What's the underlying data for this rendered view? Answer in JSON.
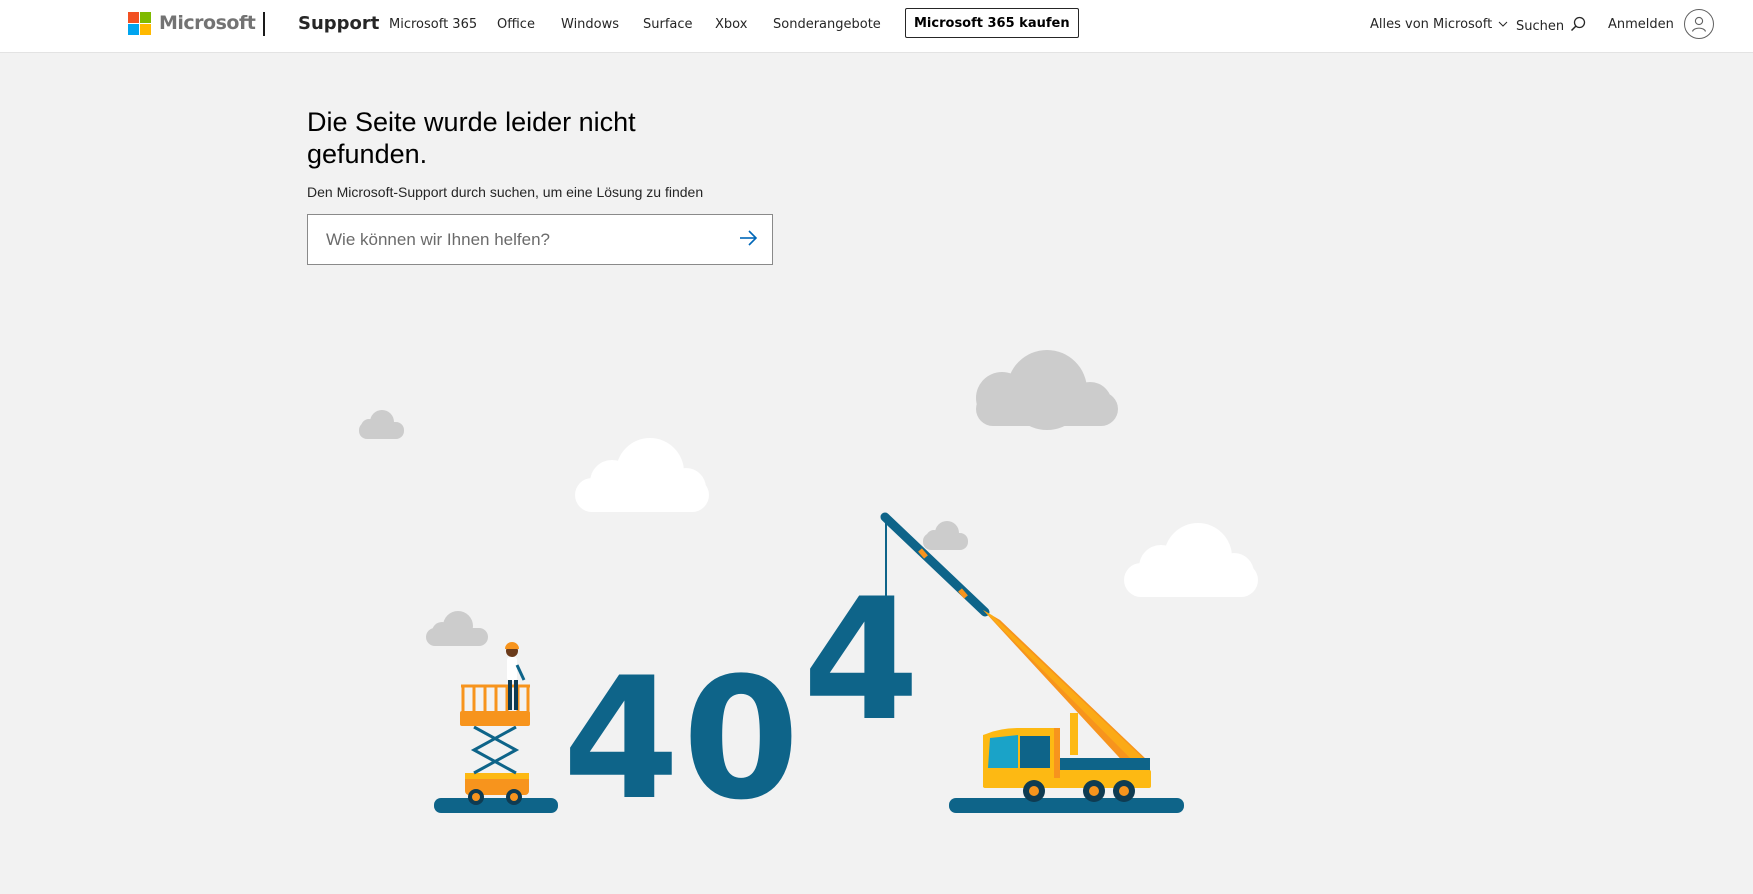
{
  "header": {
    "logo_text": "Microsoft",
    "logo_colors": [
      "#f25022",
      "#7fba00",
      "#00a4ef",
      "#ffb900"
    ],
    "support_label": "Support",
    "nav_items": [
      "Microsoft 365",
      "Office",
      "Windows",
      "Surface",
      "Xbox",
      "Sonderangebote"
    ],
    "buy_button_label": "Microsoft 365 kaufen",
    "all_microsoft_label": "Alles von Microsoft",
    "search_label": "Suchen",
    "signin_label": "Anmelden"
  },
  "main": {
    "title": "Die Seite wurde leider nicht gefunden.",
    "subtitle": "Den Microsoft-Support durch suchen, um eine Lösung zu finden",
    "search": {
      "placeholder": "Wie können wir Ihnen helfen?",
      "value": ""
    }
  },
  "illustration": {
    "digits": [
      "4",
      "0",
      "4"
    ],
    "colors": {
      "digit": "#0e6489",
      "cloud_gray": "#cccccc",
      "cloud_white": "#ffffff",
      "orange": "#f7941d",
      "yellow": "#fdb913",
      "ground": "#0e6489"
    }
  },
  "icons": {
    "search": "search-icon",
    "arrow": "arrow-right-icon",
    "chevron": "chevron-down-icon",
    "user": "user-icon"
  }
}
